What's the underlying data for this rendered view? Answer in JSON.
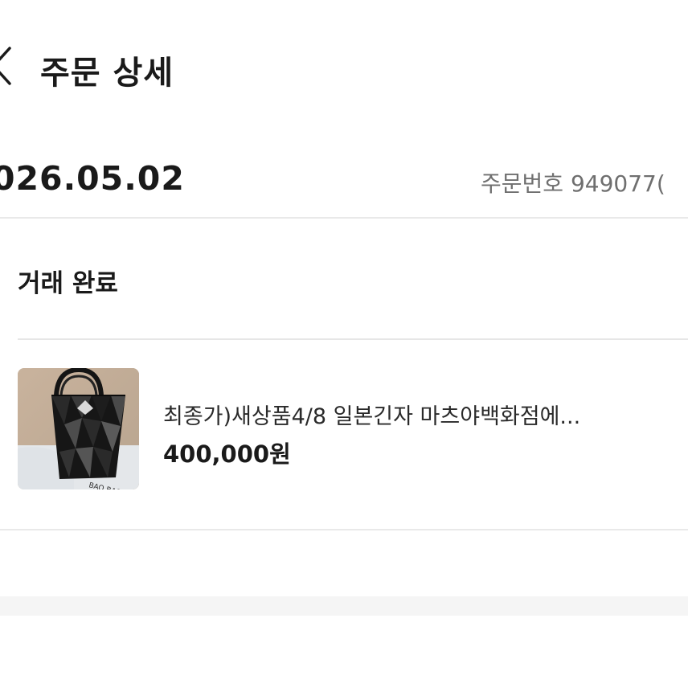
{
  "header": {
    "title": "주문 상세",
    "back_icon": "chevron-left-icon"
  },
  "order": {
    "date": "026.05.02",
    "number_label": "주문번호 949077("
  },
  "status": {
    "label": "거래 완료"
  },
  "product": {
    "name": "최종가)새상품4/8 일본긴자 마츠야백화점에...",
    "price": "400,000원",
    "thumbnail_icon": "tote-bag-image"
  },
  "colors": {
    "text_primary": "#1a1a1a",
    "text_secondary": "#6f6f6f",
    "divider": "#e9e9e9",
    "band": "#f5f5f5"
  }
}
